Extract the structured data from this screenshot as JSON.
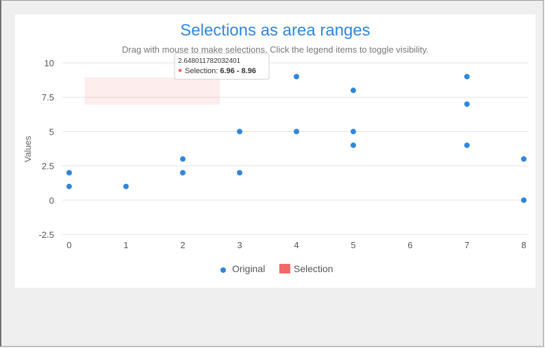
{
  "chart_data": {
    "type": "scatter",
    "title": "Selections as area ranges",
    "subtitle": "Drag with mouse to make selections. Click the legend items to toggle visibility.",
    "ylabel": "Values",
    "xlabel": "",
    "xlim": [
      0,
      8
    ],
    "ylim": [
      -2.5,
      10
    ],
    "x_ticks": [
      "0",
      "1",
      "2",
      "3",
      "4",
      "5",
      "6",
      "7",
      "8"
    ],
    "y_ticks": [
      "10",
      "7.5",
      "5",
      "2.5",
      "0",
      "-2.5"
    ],
    "grid": true,
    "legend": "bottom-center",
    "series": [
      {
        "name": "Original",
        "color": "#2f86dd",
        "points": [
          [
            0,
            2
          ],
          [
            0,
            1
          ],
          [
            1,
            1
          ],
          [
            2,
            3
          ],
          [
            2,
            2
          ],
          [
            3,
            5
          ],
          [
            3,
            2
          ],
          [
            4,
            9
          ],
          [
            4,
            5
          ],
          [
            5,
            8
          ],
          [
            5,
            5
          ],
          [
            5,
            4
          ],
          [
            7,
            9
          ],
          [
            7,
            7
          ],
          [
            7,
            4
          ],
          [
            8,
            3
          ],
          [
            8,
            0
          ]
        ]
      },
      {
        "name": "Selection",
        "color": "#f06a6a",
        "area": {
          "x_from": 0.27,
          "x_to": 2.65,
          "y_from": 6.96,
          "y_to": 8.96
        }
      }
    ],
    "tooltip": {
      "header": "2.648011782032401",
      "label": "Selection: ",
      "value": "6.96 - 8.96"
    }
  }
}
